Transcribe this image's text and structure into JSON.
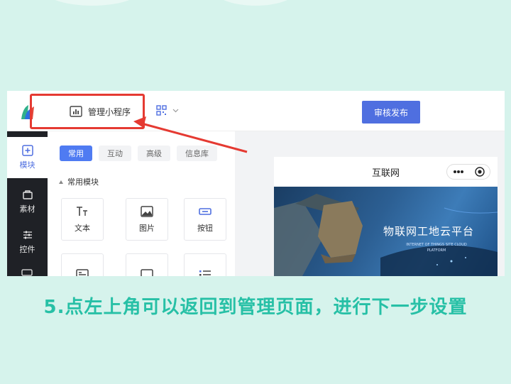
{
  "topbar": {
    "manage_label": "管理小程序",
    "publish_label": "审核发布"
  },
  "left_nav": {
    "items": [
      {
        "label": "模块",
        "icon": "plus-square-icon"
      },
      {
        "label": "素材",
        "icon": "bag-icon"
      },
      {
        "label": "控件",
        "icon": "sliders-icon"
      }
    ]
  },
  "panel": {
    "tabs": [
      "常用",
      "互动",
      "高级",
      "信息库"
    ],
    "section_title": "常用模块",
    "widgets": [
      {
        "label": "文本",
        "icon": "text-icon"
      },
      {
        "label": "图片",
        "icon": "image-icon"
      },
      {
        "label": "按钮",
        "icon": "button-icon"
      }
    ]
  },
  "preview": {
    "title": "互联网",
    "banner_title": "物联网工地云平台",
    "banner_subtitle": "INTERNET OF THINGS SITE CLOUD PLATFORM"
  },
  "caption": "5.点左上角可以返回到管理页面，进行下一步设置",
  "colors": {
    "background": "#d6f3ec",
    "accent": "#4f6fe0",
    "highlight": "#e53a32",
    "caption": "#27c0a6"
  }
}
